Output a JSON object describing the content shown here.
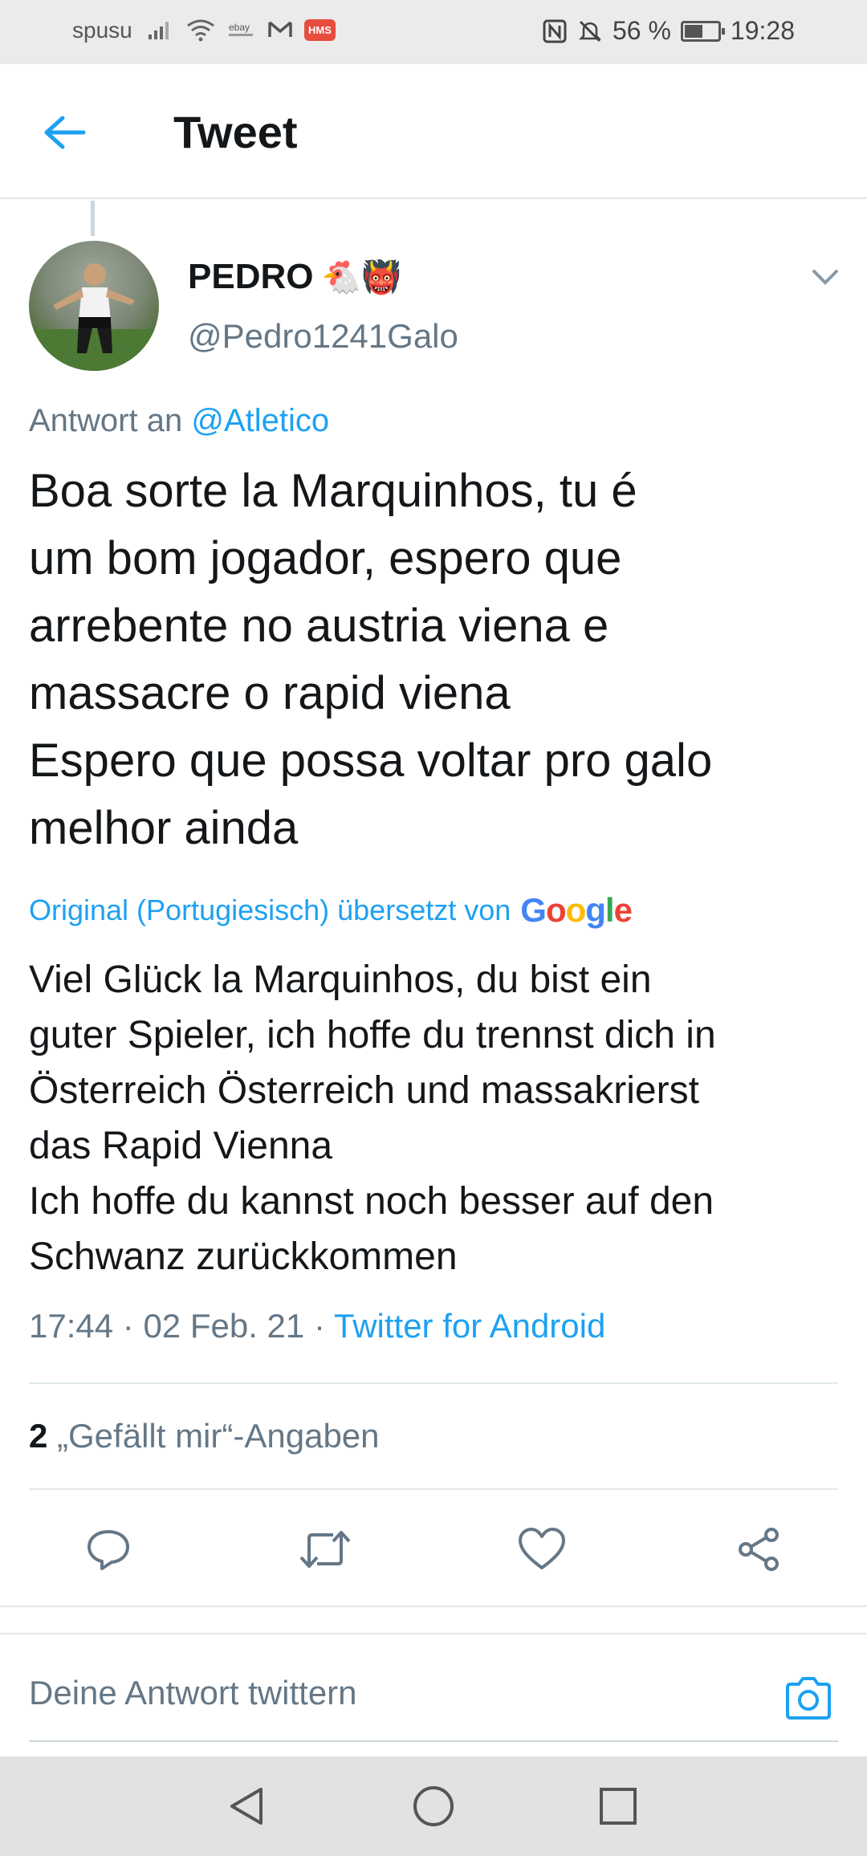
{
  "status_bar": {
    "carrier": "spusu",
    "battery": "56 %",
    "battery_level": 0.56,
    "time": "19:28",
    "icons": [
      "signal-icon",
      "wifi-icon",
      "ebay-icon",
      "gmail-icon",
      "hms-icon",
      "nfc-icon",
      "mute-icon",
      "battery-icon"
    ],
    "hms_label": "HMS"
  },
  "header": {
    "title": "Tweet",
    "accent_color": "#1da1f2"
  },
  "tweet": {
    "display_name": "PEDRO",
    "name_emojis": "🐔👹",
    "handle": "@Pedro1241Galo",
    "reply_prefix": "Antwort an",
    "reply_mention": "@Atletico",
    "text": "Boa sorte la Marquinhos, tu é\num bom jogador, espero que\narrebente no austria viena e\nmassacre o rapid viena\nEspero que possa voltar pro galo\nmelhor ainda",
    "translation_label": "Original (Portugiesisch) übersetzt von",
    "translation_provider": "Google",
    "translated_text": "Viel Glück la Marquinhos, du bist ein\nguter Spieler, ich hoffe du trennst dich in\nÖsterreich Österreich und massakrierst\ndas Rapid Vienna\n Ich hoffe du kannst noch besser auf den\nSchwanz zurückkommen",
    "time": "17:44",
    "date": "02 Feb. 21",
    "separator": "·",
    "source": "Twitter for Android",
    "likes_count": "2",
    "likes_label": "„Gefällt mir“-Angaben"
  },
  "actions": [
    "reply-icon",
    "retweet-icon",
    "like-icon",
    "share-icon"
  ],
  "reply": {
    "placeholder": "Deine Antwort twittern"
  },
  "nav": [
    "back-nav-icon",
    "home-nav-icon",
    "recents-nav-icon"
  ]
}
